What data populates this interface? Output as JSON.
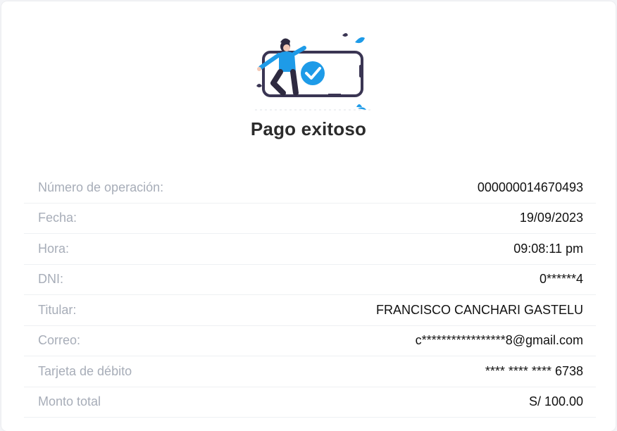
{
  "receipt": {
    "title": "Pago exitoso",
    "rows": [
      {
        "label": "Número de operación:",
        "value": "000000014670493"
      },
      {
        "label": "Fecha:",
        "value": "19/09/2023"
      },
      {
        "label": "Hora:",
        "value": "09:08:11 pm"
      },
      {
        "label": "DNI:",
        "value": "0******4"
      },
      {
        "label": "Titular:",
        "value": "FRANCISCO CANCHARI GASTELU"
      },
      {
        "label": "Correo:",
        "value": "c*****************8@gmail.com"
      },
      {
        "label": "Tarjeta de débito",
        "value": "**** **** **** 6738"
      },
      {
        "label": "Monto total",
        "value": "S/ 100.00"
      }
    ]
  },
  "colors": {
    "accent": "#1e9be8",
    "phone_outline": "#3a3553",
    "label": "#a7adb8",
    "value": "#111111",
    "title": "#2b2b2b"
  },
  "icons": {
    "illustration": "success-payment-illustration",
    "check": "check-circle-icon"
  }
}
